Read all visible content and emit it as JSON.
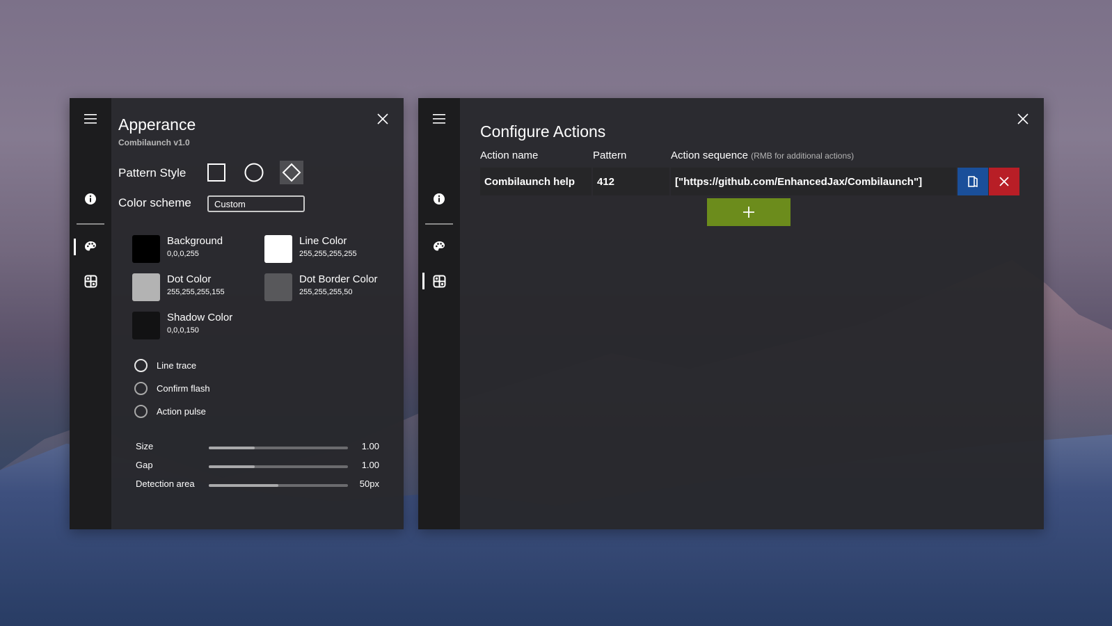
{
  "theme": {
    "accent_add": "#6c8c1c",
    "accent_blue": "#1a4f9a",
    "accent_red": "#b81e26"
  },
  "appearance": {
    "title": "Apperance",
    "subtitle": "Combilaunch v1.0",
    "pattern_style_label": "Pattern Style",
    "pattern_styles": [
      "square",
      "circle",
      "diamond"
    ],
    "pattern_style_selected": "diamond",
    "color_scheme_label": "Color scheme",
    "color_scheme_value": "Custom",
    "colors": [
      {
        "name": "Background",
        "value": "0,0,0,255",
        "swatch": "#000000"
      },
      {
        "name": "Line Color",
        "value": "255,255,255,255",
        "swatch": "#ffffff"
      },
      {
        "name": "Dot Color",
        "value": "255,255,255,155",
        "swatch": "#b3b3b3"
      },
      {
        "name": "Dot Border Color",
        "value": "255,255,255,50",
        "swatch": "#58585b"
      },
      {
        "name": "Shadow Color",
        "value": "0,0,0,150",
        "swatch": "#121213"
      }
    ],
    "options": [
      {
        "label": "Line trace"
      },
      {
        "label": "Confirm flash"
      },
      {
        "label": "Action pulse"
      }
    ],
    "sliders": [
      {
        "label": "Size",
        "value_text": "1.00",
        "fill": 0.33
      },
      {
        "label": "Gap",
        "value_text": "1.00",
        "fill": 0.33
      },
      {
        "label": "Detection area",
        "value_text": "50px",
        "fill": 0.5
      }
    ]
  },
  "actions": {
    "title": "Configure Actions",
    "columns": {
      "name": "Action name",
      "pattern": "Pattern",
      "sequence": "Action sequence",
      "sequence_hint": "(RMB for additional actions)"
    },
    "rows": [
      {
        "name": "Combilaunch help",
        "pattern": "412",
        "sequence": "[\"https://github.com/EnhancedJax/Combilaunch\"]"
      }
    ]
  },
  "icons": {
    "menu": "hamburger-menu-icon",
    "info": "info-icon",
    "palette": "palette-icon",
    "actions": "actions-grid-icon",
    "close": "close-icon",
    "edit": "edit-icon",
    "delete": "delete-x-icon",
    "add": "plus-icon"
  }
}
